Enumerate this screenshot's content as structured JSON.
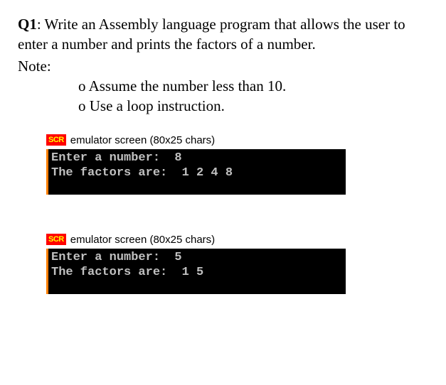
{
  "question": {
    "label": "Q1",
    "text": ": Write an Assembly language program that allows the user to enter a number and prints the factors of a number.",
    "note_label": "Note:",
    "notes": [
      "Assume the number less than 10.",
      "Use a loop instruction."
    ]
  },
  "emulators": [
    {
      "icon_text": "SCR",
      "title": "emulator screen (80x25 chars)",
      "lines": [
        "Enter a number:  8",
        "The factors are:  1 2 4 8"
      ]
    },
    {
      "icon_text": "SCR",
      "title": "emulator screen (80x25 chars)",
      "lines": [
        "Enter a number:  5",
        "The factors are:  1 5"
      ]
    }
  ]
}
